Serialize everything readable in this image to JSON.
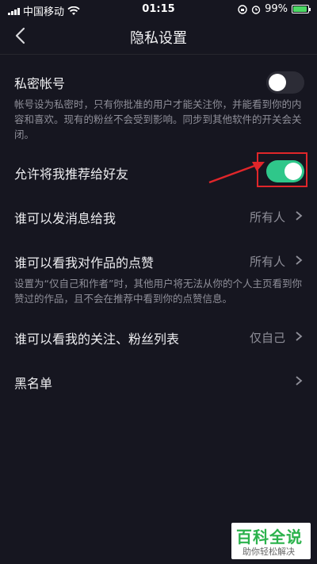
{
  "status_bar": {
    "carrier": "中国移动",
    "time": "01:15",
    "battery_percent": "99%"
  },
  "nav": {
    "title": "隐私设置",
    "back_icon": "chevron-left-icon"
  },
  "settings": {
    "private_account": {
      "title": "私密帐号",
      "description": "帐号设为私密时，只有你批准的用户才能关注你，并能看到你的内容和喜欢。现有的粉丝不会受到影响。同步到其他软件的开关会关闭。",
      "enabled": false
    },
    "recommend_to_friends": {
      "title": "允许将我推荐给好友",
      "enabled": true
    },
    "who_can_message": {
      "title": "谁可以发消息给我",
      "value": "所有人"
    },
    "who_can_see_likes": {
      "title": "谁可以看我对作品的点赞",
      "value": "所有人",
      "description": "设置为“仅自己和作者”时，其他用户将无法从你的个人主页看到你赞过的作品，且不会在推荐中看到你的点赞信息。"
    },
    "who_can_see_follows": {
      "title": "谁可以看我的关注、粉丝列表",
      "value": "仅自己"
    },
    "blacklist": {
      "title": "黑名单"
    }
  },
  "watermark": {
    "title": "百科全说",
    "subtitle": "助你轻松解决"
  },
  "colors": {
    "background": "#161620",
    "toggle_on": "#2fc78a",
    "toggle_off": "#2c2c36",
    "annotation_red": "#e0262a"
  }
}
